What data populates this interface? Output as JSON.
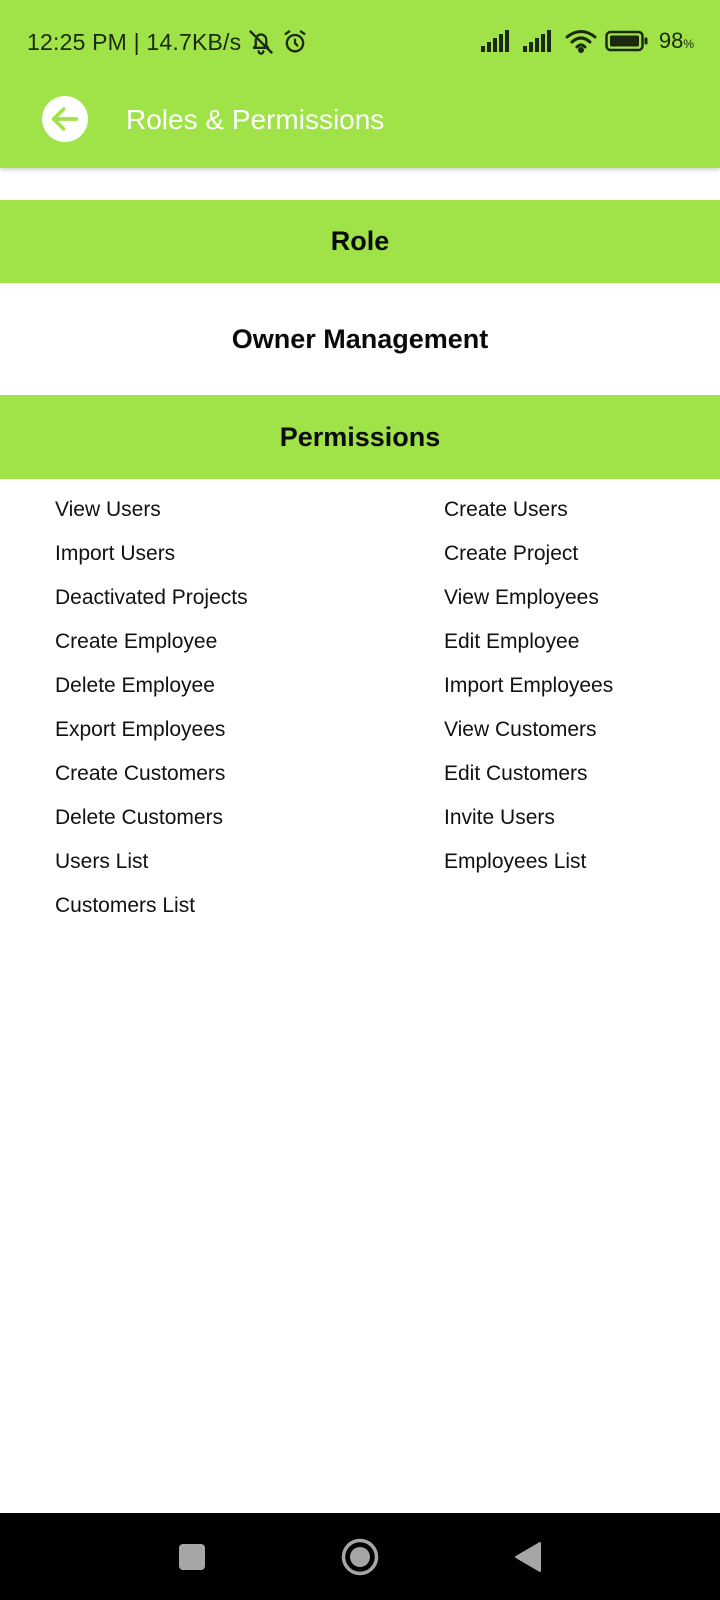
{
  "status_bar": {
    "time_speed": "12:25 PM | 14.7KB/s",
    "battery_percent": "98",
    "battery_unit": "%",
    "icons": [
      "bell-off-icon",
      "alarm-icon",
      "signal-icon",
      "signal-icon",
      "wifi-icon",
      "battery-icon"
    ]
  },
  "app_bar": {
    "title": "Roles & Permissions",
    "back_icon": "arrow-left-icon"
  },
  "role_section": {
    "header": "Role",
    "value": "Owner Management"
  },
  "permissions_section": {
    "header": "Permissions",
    "items": [
      "View Users",
      "Create Users",
      "Import Users",
      "Create Project",
      "Deactivated Projects",
      "View Employees",
      "Create Employee",
      "Edit Employee",
      "Delete Employee",
      "Import Employees",
      "Export Employees",
      "View Customers",
      "Create Customers",
      "Edit Customers",
      "Delete Customers",
      "Invite Users",
      "Users List",
      "Employees List",
      "Customers List"
    ]
  },
  "nav_bar": {
    "icons": [
      "recent-apps-icon",
      "home-icon",
      "back-icon"
    ]
  },
  "colors": {
    "accent": "#9fe348",
    "nav_background": "#000000"
  }
}
